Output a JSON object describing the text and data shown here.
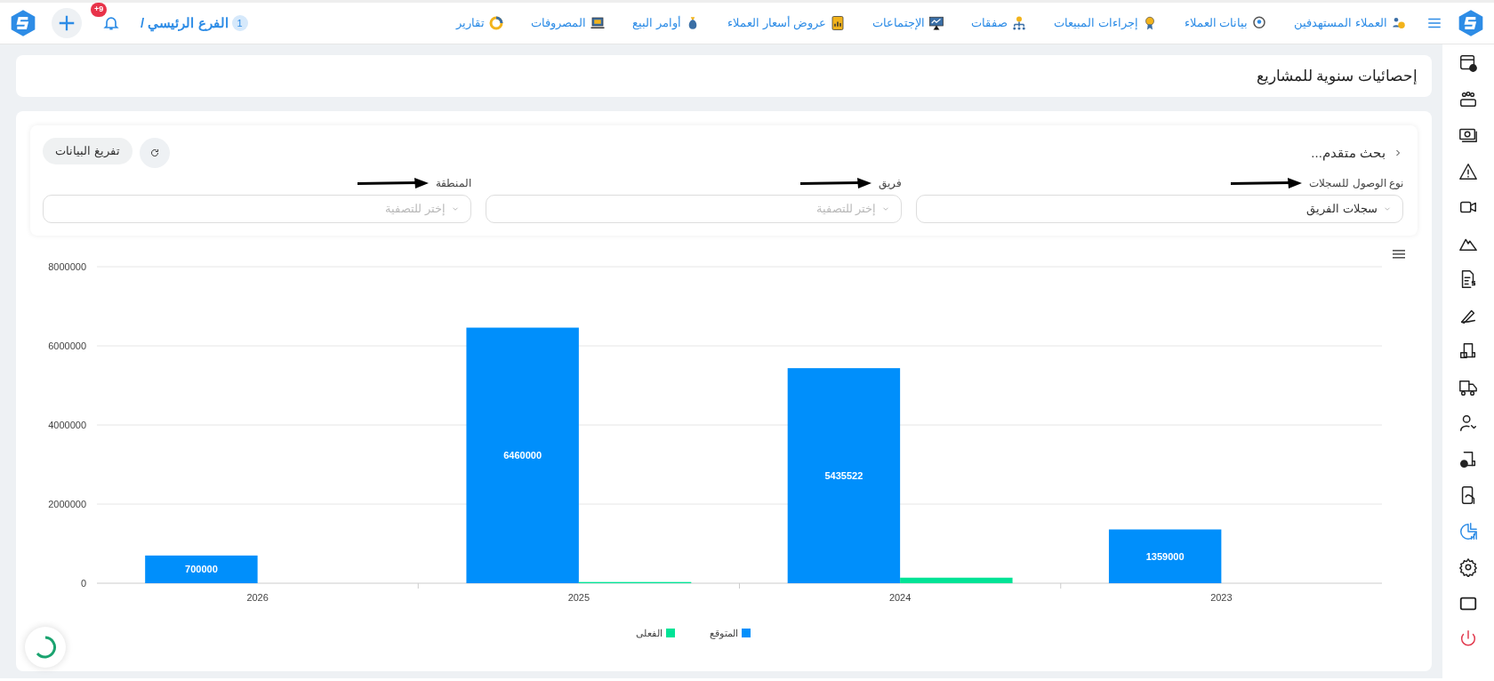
{
  "top_nav": {
    "items": [
      {
        "label": "العملاء المستهدفين"
      },
      {
        "label": "بيانات العملاء"
      },
      {
        "label": "إجراءات المبيعات"
      },
      {
        "label": "صفقات"
      },
      {
        "label": "الإجتماعات"
      },
      {
        "label": "عروض أسعار العملاء"
      },
      {
        "label": "أوامر البيع"
      },
      {
        "label": "المصروفات"
      },
      {
        "label": "تقارير"
      }
    ],
    "branch": {
      "number": "1",
      "name": "الفرع الرئيسي /"
    },
    "notifications_badge": "+9"
  },
  "sidebar": {
    "items": [
      {
        "selected": false
      },
      {
        "selected": false
      },
      {
        "selected": false
      },
      {
        "selected": false
      },
      {
        "selected": false
      },
      {
        "selected": false
      },
      {
        "selected": false
      },
      {
        "selected": false
      },
      {
        "selected": false
      },
      {
        "selected": false
      },
      {
        "selected": false
      },
      {
        "selected": false
      },
      {
        "selected": false
      },
      {
        "selected": true
      },
      {
        "selected": false
      },
      {
        "selected": false
      },
      {
        "selected": false
      }
    ]
  },
  "page_title": "إحصائيات سنوية للمشاريع",
  "filters": {
    "title": "بحث متقدم...",
    "export_button": "تفريغ البيانات",
    "fields": [
      {
        "label": "نوع الوصول للسجلات",
        "value": "سجلات الفريق"
      },
      {
        "label": "فريق",
        "placeholder": "إختر للتصفية"
      },
      {
        "label": "المنطقة",
        "placeholder": "إختر للتصفية"
      }
    ]
  },
  "chart_data": {
    "type": "bar",
    "categories": [
      "2026",
      "2025",
      "2024",
      "2023"
    ],
    "series": [
      {
        "name": "المتوقع",
        "color": "#008ffb",
        "values": [
          700000,
          6460000,
          5435522,
          1359000
        ]
      },
      {
        "name": "الفعلى",
        "color": "#00e396",
        "values": [
          null,
          30000,
          140000,
          null
        ]
      }
    ],
    "ylim": [
      0,
      8000000
    ],
    "yticks": [
      0,
      2000000,
      4000000,
      6000000,
      8000000
    ],
    "grid": true,
    "legend": "bottom",
    "value_labels": [
      [
        "700000",
        "6460000",
        "5435522",
        "1359000"
      ],
      [
        null,
        null,
        null,
        null
      ]
    ]
  }
}
